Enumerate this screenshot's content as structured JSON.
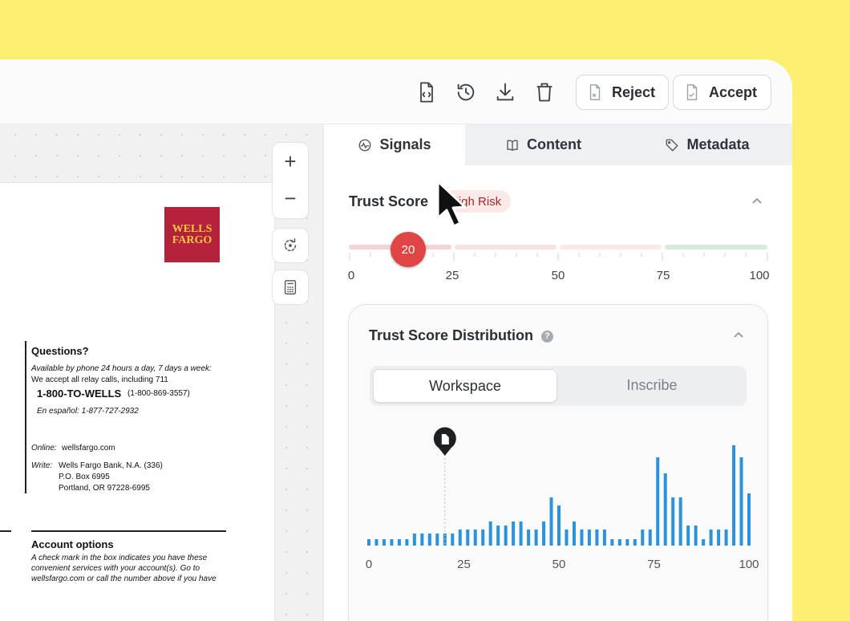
{
  "toolbar": {
    "icons": [
      "code-file-icon",
      "history-icon",
      "download-icon",
      "trash-icon"
    ],
    "reject_label": "Reject",
    "accept_label": "Accept"
  },
  "viewer": {
    "zoom_in": "+",
    "zoom_out": "−",
    "tools": [
      "rotate-icon",
      "calculator-icon"
    ]
  },
  "document": {
    "logo_line1": "WELLS",
    "logo_line2": "FARGO",
    "questions_heading": "Questions?",
    "availability": "Available by phone 24 hours a day, 7 days a week:",
    "relay": "We accept all relay calls, including 711",
    "phone_main": "1-800-TO-WELLS",
    "phone_alt": "(1-800-869-3557)",
    "spanish": "En español: 1-877-727-2932",
    "online_label": "Online:",
    "online_value": "wellsfargo.com",
    "write_label": "Write:",
    "write_line1": "Wells Fargo Bank, N.A. (336)",
    "write_line2": "P.O. Box 6995",
    "write_line3": "Portland, OR  97228-6995",
    "account_heading": "Account options",
    "account_line1": "A check mark in the box indicates you have these",
    "account_line2": "convenient services with your account(s).  Go to",
    "account_line3": "wellsfargo.com or call the number above if you have"
  },
  "tabs": [
    {
      "label": "Signals",
      "icon": "signals-icon",
      "active": true
    },
    {
      "label": "Content",
      "icon": "book-icon",
      "active": false
    },
    {
      "label": "Metadata",
      "icon": "tag-icon",
      "active": false
    }
  ],
  "trust": {
    "title": "Trust Score",
    "badge": "High Risk",
    "value": 20,
    "scale": [
      "0",
      "25",
      "50",
      "75",
      "100"
    ],
    "colors": {
      "seg1": "#f8d3d3",
      "seg2": "#fbe1de",
      "seg3": "#fce9e5",
      "seg4": "#d6ecd9",
      "knob": "#e04545"
    }
  },
  "distribution": {
    "title": "Trust Score Distribution",
    "help": "?",
    "options": [
      "Workspace",
      "Inscribe"
    ],
    "selected": "Workspace",
    "marker_value": 20
  },
  "chart_data": {
    "type": "bar",
    "title": "Trust Score Distribution",
    "color": "#2b93dd",
    "xlim": [
      0,
      100
    ],
    "xticks": [
      "0",
      "25",
      "50",
      "75",
      "100"
    ],
    "x": [
      0,
      2,
      4,
      6,
      8,
      10,
      12,
      14,
      16,
      18,
      20,
      22,
      24,
      26,
      28,
      30,
      32,
      34,
      36,
      38,
      40,
      42,
      44,
      46,
      48,
      50,
      52,
      54,
      56,
      58,
      60,
      62,
      64,
      66,
      68,
      70,
      72,
      74,
      76,
      78,
      80,
      82,
      84,
      86,
      88,
      90,
      92,
      94,
      96,
      98,
      100
    ],
    "values": [
      8,
      8,
      8,
      8,
      8,
      8,
      15,
      15,
      15,
      15,
      15,
      15,
      20,
      20,
      20,
      20,
      30,
      25,
      25,
      30,
      30,
      20,
      20,
      30,
      60,
      50,
      20,
      30,
      20,
      20,
      20,
      20,
      8,
      8,
      8,
      8,
      20,
      20,
      110,
      90,
      60,
      60,
      25,
      25,
      8,
      20,
      20,
      20,
      125,
      110,
      65
    ]
  }
}
